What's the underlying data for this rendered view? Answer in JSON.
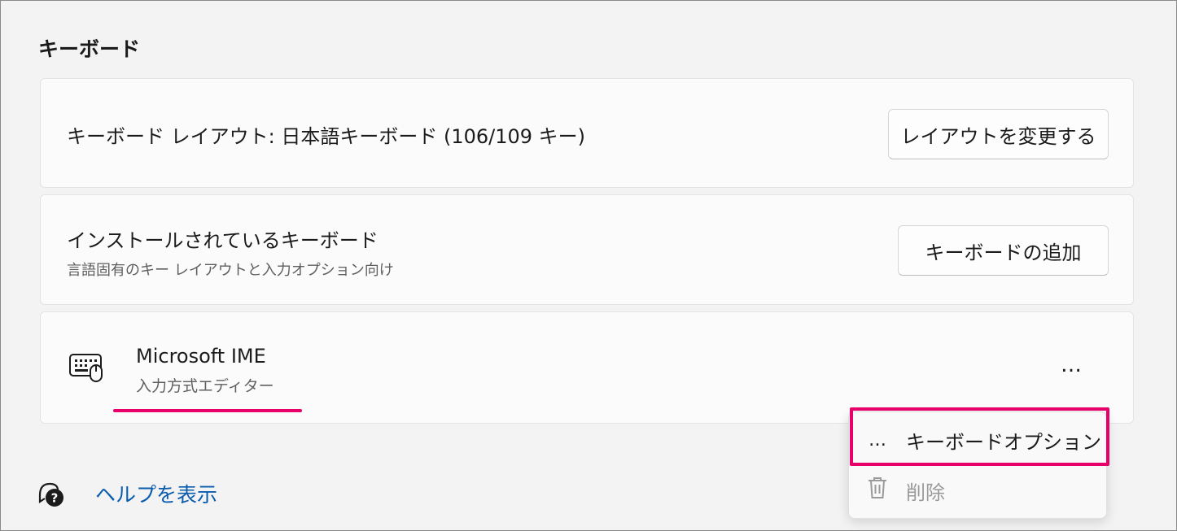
{
  "section": {
    "title": "キーボード"
  },
  "layout_card": {
    "text": "キーボード レイアウト: 日本語キーボード (106/109 キー)",
    "button_label": "レイアウトを変更する"
  },
  "installed_card": {
    "title": "インストールされているキーボード",
    "subtitle": "言語固有のキー レイアウトと入力オプション向け",
    "button_label": "キーボードの追加"
  },
  "ime_card": {
    "icon": "keyboard-mouse-icon",
    "name": "Microsoft IME",
    "subtitle": "入力方式エディター",
    "more_label": "…"
  },
  "flyout": {
    "items": [
      {
        "icon": "more-icon",
        "icon_glyph": "…",
        "label": "キーボードオプション"
      },
      {
        "icon": "trash-icon",
        "label": "削除"
      }
    ]
  },
  "help": {
    "icon": "help-chat-icon",
    "label": "ヘルプを表示"
  },
  "colors": {
    "highlight": "#e8006a",
    "link": "#0a5cad",
    "background": "#f3f3f3"
  }
}
